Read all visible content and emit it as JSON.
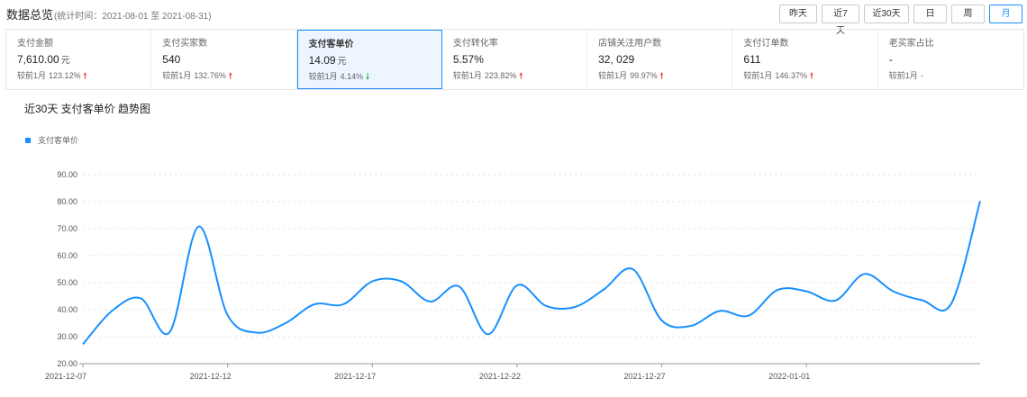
{
  "header": {
    "title": "数据总览",
    "range": "(统计时间：2021-08-01 至 2021-08-31)",
    "buttons": [
      {
        "label": "昨天",
        "active": false
      },
      {
        "label": "近7天",
        "active": false
      },
      {
        "label": "近30天",
        "active": false
      },
      {
        "label": "日",
        "active": false
      },
      {
        "label": "周",
        "active": false
      },
      {
        "label": "月",
        "active": true
      }
    ]
  },
  "metrics": [
    {
      "label": "支付金额",
      "value": "7,610.00",
      "unit": "元",
      "compare": "较前1月",
      "pct": "123.12%",
      "trend": "up",
      "active": false
    },
    {
      "label": "支付买家数",
      "value": "540",
      "unit": "",
      "compare": "较前1月",
      "pct": "132.76%",
      "trend": "up",
      "active": false
    },
    {
      "label": "支付客单价",
      "value": "14.09",
      "unit": "元",
      "compare": "较前1月",
      "pct": "4.14%",
      "trend": "down",
      "active": true
    },
    {
      "label": "支付转化率",
      "value": "5.57%",
      "unit": "",
      "compare": "较前1月",
      "pct": "223.82%",
      "trend": "up",
      "active": false
    },
    {
      "label": "店铺关注用户数",
      "value": "32, 029",
      "unit": "",
      "compare": "较前1月",
      "pct": "99.97%",
      "trend": "up",
      "active": false
    },
    {
      "label": "支付订单数",
      "value": "611",
      "unit": "",
      "compare": "较前1月",
      "pct": "146.37%",
      "trend": "up",
      "active": false
    },
    {
      "label": "老买家占比",
      "value": "-",
      "unit": "",
      "compare": "较前1月",
      "pct": "-",
      "trend": "none",
      "active": false
    }
  ],
  "chart": {
    "title": "近30天 支付客单价 趋势图",
    "legend": "支付客单价"
  },
  "colors": {
    "accent": "#1890ff",
    "up": "#f04134",
    "down": "#2db84d"
  },
  "chart_data": {
    "type": "line",
    "series": [
      {
        "name": "支付客单价",
        "values": [
          27.2,
          39.5,
          44.2,
          31.7,
          70.8,
          38.0,
          31.5,
          35.0,
          42.0,
          42.0,
          50.5,
          50.5,
          43.0,
          48.6,
          30.9,
          49.0,
          41.4,
          41.0,
          47.5,
          55.0,
          36.0,
          34.0,
          39.5,
          37.8,
          47.3,
          46.8,
          43.4,
          53.2,
          46.8,
          43.5,
          42.2,
          80.2
        ]
      }
    ],
    "x": [
      "2021-12-07",
      "2021-12-08",
      "2021-12-09",
      "2021-12-10",
      "2021-12-11",
      "2021-12-12",
      "2021-12-13",
      "2021-12-14",
      "2021-12-15",
      "2021-12-16",
      "2021-12-17",
      "2021-12-18",
      "2021-12-19",
      "2021-12-20",
      "2021-12-21",
      "2021-12-22",
      "2021-12-23",
      "2021-12-24",
      "2021-12-25",
      "2021-12-26",
      "2021-12-27",
      "2021-12-28",
      "2021-12-29",
      "2021-12-30",
      "2021-12-31",
      "2022-01-01",
      "2022-01-02",
      "2022-01-03",
      "2022-01-04",
      "2022-01-05",
      "2022-01-06",
      "2022-01-07"
    ],
    "xticks": [
      "2021-12-07",
      "2021-12-12",
      "2021-12-17",
      "2021-12-22",
      "2021-12-27",
      "2022-01-01"
    ],
    "yticks": [
      "20.00",
      "30.00",
      "40.00",
      "50.00",
      "60.00",
      "70.00",
      "80.00",
      "90.00"
    ],
    "ylim": [
      20,
      90
    ],
    "grid": true,
    "legend_position": "top-left"
  }
}
